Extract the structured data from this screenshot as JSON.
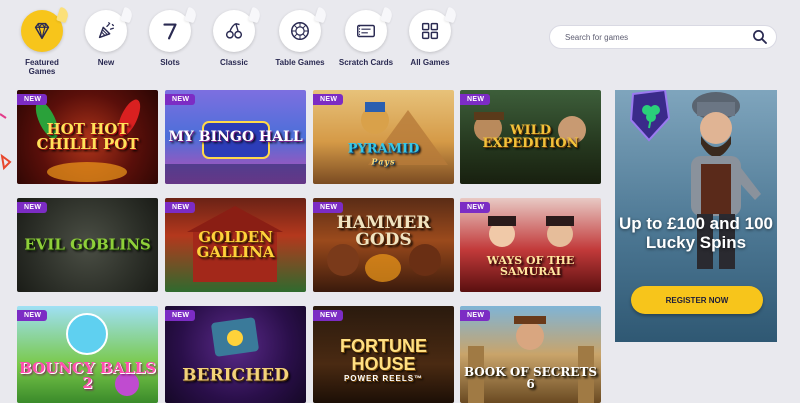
{
  "categories": [
    {
      "label": "Featured\nGames",
      "icon": "diamond-icon",
      "active": true
    },
    {
      "label": "New",
      "icon": "party-popper-icon",
      "active": false
    },
    {
      "label": "Slots",
      "icon": "seven-icon",
      "active": false
    },
    {
      "label": "Classic",
      "icon": "cherries-icon",
      "active": false
    },
    {
      "label": "Table Games",
      "icon": "roulette-wheel-icon",
      "active": false
    },
    {
      "label": "Scratch Cards",
      "icon": "ticket-icon",
      "active": false
    },
    {
      "label": "All Games",
      "icon": "grid-icon",
      "active": false
    }
  ],
  "search": {
    "placeholder": "Search for games",
    "icon": "search-icon"
  },
  "games": [
    {
      "title": "HOT HOT CHILLI POT",
      "subtitle": "",
      "badge": "NEW"
    },
    {
      "title": "MY BINGO HALL",
      "subtitle": "",
      "badge": "NEW"
    },
    {
      "title": "PYRAMID",
      "subtitle": "Pays",
      "badge": "NEW"
    },
    {
      "title": "WILD EXPEDITION",
      "subtitle": "",
      "badge": "NEW"
    },
    {
      "title": "EVIL GOBLINS",
      "subtitle": "",
      "badge": "NEW"
    },
    {
      "title": "GOLDEN GALLINA",
      "subtitle": "",
      "badge": "NEW"
    },
    {
      "title": "HAMMER GODS",
      "subtitle": "",
      "badge": "NEW"
    },
    {
      "title": "WAYS OF THE SAMURAI",
      "subtitle": "",
      "badge": "NEW"
    },
    {
      "title": "BOUNCY BALLS 2",
      "subtitle": "",
      "badge": "NEW"
    },
    {
      "title": "BERICHED",
      "subtitle": "",
      "badge": "NEW"
    },
    {
      "title": "FORTUNE HOUSE",
      "subtitle": "POWER REELS™",
      "badge": "NEW"
    },
    {
      "title": "BOOK OF SECRETS 6",
      "subtitle": "",
      "badge": "NEW"
    }
  ],
  "promo": {
    "headline": "Up to £100 and 100 Lucky Spins",
    "cta": "REGISTER NOW"
  },
  "colors": {
    "background": "#e9e9ee",
    "accent_yellow": "#f7c51b",
    "badge_purple": "#7c2cc4",
    "nav_text": "#2a2a52"
  }
}
